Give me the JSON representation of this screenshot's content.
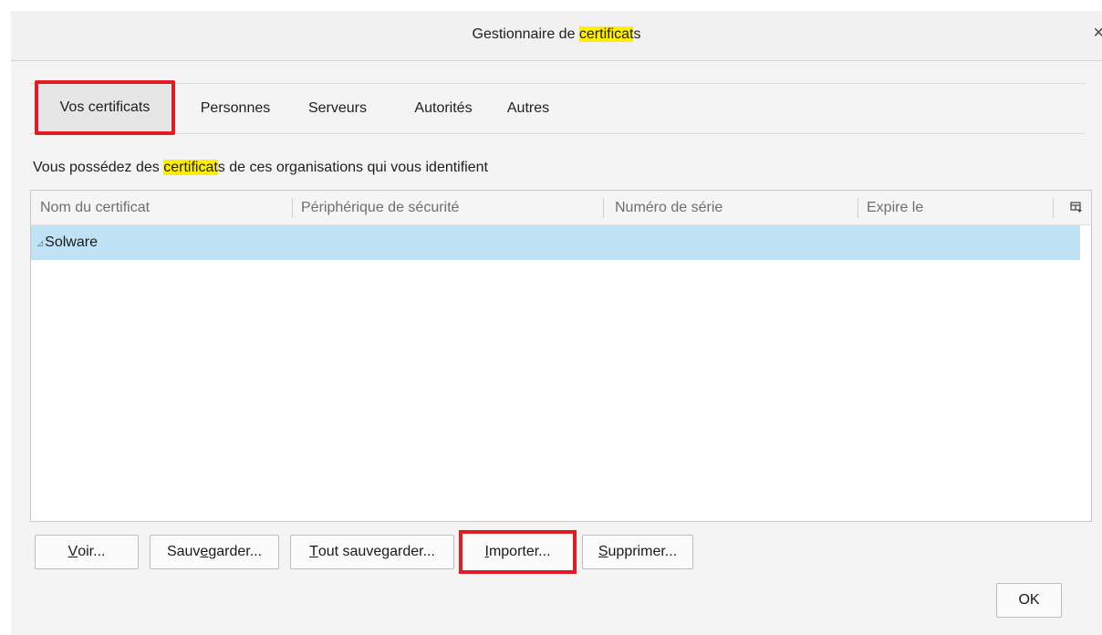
{
  "window": {
    "title_prefix": "Gestionnaire de ",
    "title_highlight": "certificat",
    "title_suffix": "s",
    "close_glyph": "×"
  },
  "tabs": [
    {
      "label": "Vos certificats",
      "active": true
    },
    {
      "label": "Personnes",
      "active": false
    },
    {
      "label": "Serveurs",
      "active": false
    },
    {
      "label": "Autorités",
      "active": false
    },
    {
      "label": "Autres",
      "active": false
    }
  ],
  "intro": {
    "prefix": "Vous possédez des ",
    "highlight": "certificat",
    "suffix": "s de ces organisations qui vous identifient"
  },
  "tree": {
    "columns": [
      "Nom du certificat",
      "Périphérique de sécurité",
      "Numéro de série",
      "Expire le"
    ],
    "rows": [
      {
        "label": "Solware",
        "twisty": "◿"
      }
    ]
  },
  "buttons": {
    "view": {
      "accel": "V",
      "rest": "oir..."
    },
    "backup": {
      "pre": "Sauv",
      "accel": "e",
      "rest": "garder..."
    },
    "backup_all": {
      "accel": "T",
      "rest": "out sauvegarder..."
    },
    "import": {
      "accel": "I",
      "rest": "mporter..."
    },
    "delete": {
      "accel": "S",
      "rest": "upprimer..."
    },
    "ok": "OK"
  },
  "colors": {
    "highlight": "#ffee00",
    "annotation_red": "#e31b23",
    "selected_row": "#bfe3f5"
  }
}
